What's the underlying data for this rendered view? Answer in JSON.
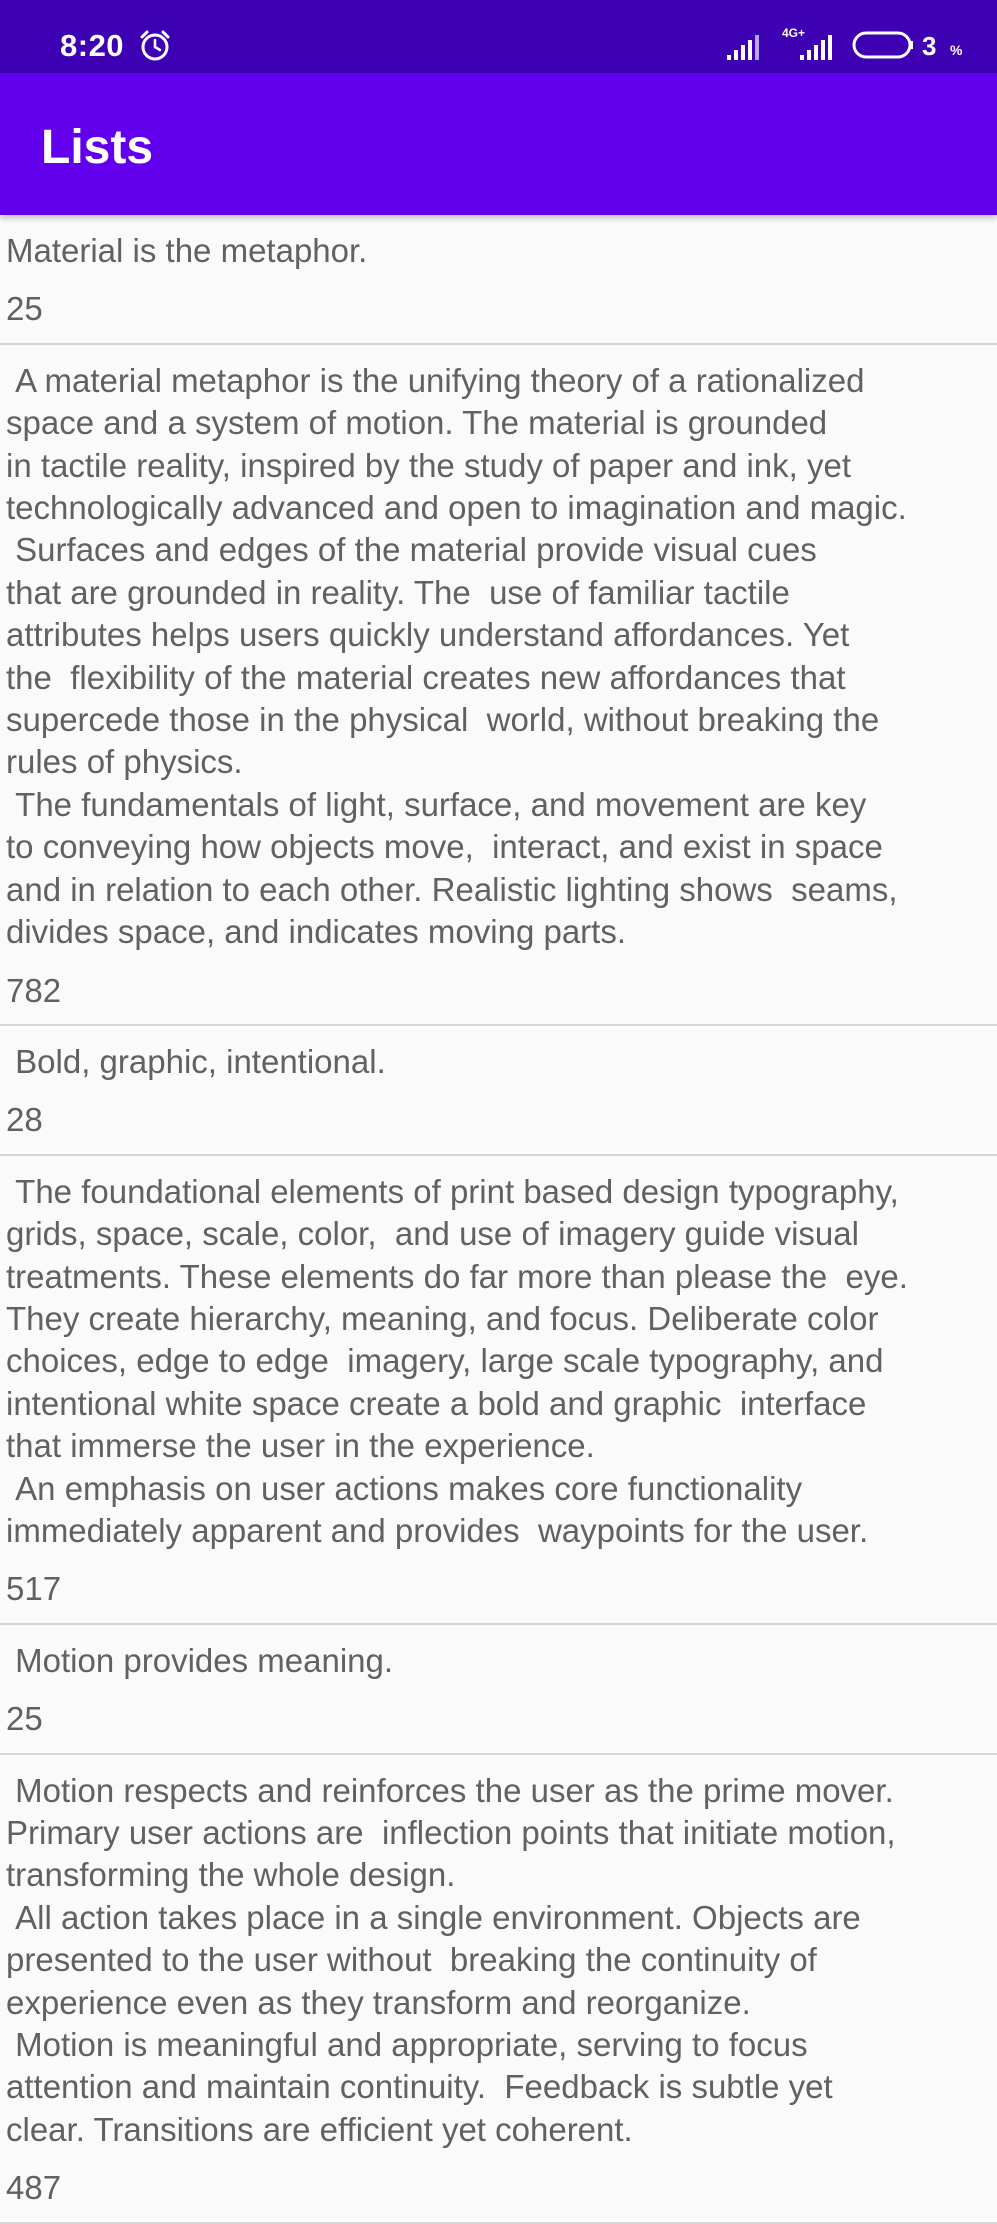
{
  "status_bar": {
    "time": "8:20",
    "network": "4G+",
    "battery_level": "3",
    "battery_unit": "%"
  },
  "app_bar": {
    "title": "Lists"
  },
  "items": [
    {
      "text": "Material is the metaphor.",
      "count": "25"
    },
    {
      "text": " A material metaphor is the unifying theory of a rationalized\nspace and a system of motion. The material is grounded\nin tactile reality, inspired by the study of paper and ink, yet\ntechnologically advanced and open to imagination and magic.\n Surfaces and edges of the material provide visual cues\nthat are grounded in reality. The  use of familiar tactile\nattributes helps users quickly understand affordances. Yet\nthe  flexibility of the material creates new affordances that\nsupercede those in the physical  world, without breaking the\nrules of physics.\n The fundamentals of light, surface, and movement are key\nto conveying how objects move,  interact, and exist in space\nand in relation to each other. Realistic lighting shows  seams,\ndivides space, and indicates moving parts.",
      "count": "782"
    },
    {
      "text": " Bold, graphic, intentional.",
      "count": "28"
    },
    {
      "text": " The foundational elements of print based design typography,\ngrids, space, scale, color,  and use of imagery guide visual\ntreatments. These elements do far more than please the  eye.\nThey create hierarchy, meaning, and focus. Deliberate color\nchoices, edge to edge  imagery, large scale typography, and\nintentional white space create a bold and graphic  interface\nthat immerse the user in the experience.\n An emphasis on user actions makes core functionality\nimmediately apparent and provides  waypoints for the user.",
      "count": "517"
    },
    {
      "text": " Motion provides meaning.",
      "count": "25"
    },
    {
      "text": " Motion respects and reinforces the user as the prime mover.\nPrimary user actions are  inflection points that initiate motion,\ntransforming the whole design.\n All action takes place in a single environment. Objects are\npresented to the user without  breaking the continuity of\nexperience even as they transform and reorganize.\n Motion is meaningful and appropriate, serving to focus\nattention and maintain continuity.  Feedback is subtle yet\nclear. Transitions are efficient yet coherent.",
      "count": "487"
    }
  ]
}
